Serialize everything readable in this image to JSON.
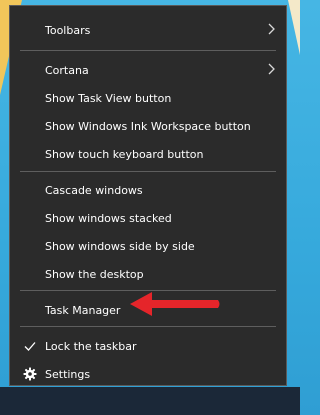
{
  "menu": {
    "items": [
      {
        "label": "Toolbars",
        "submenu": true
      },
      {
        "label": "Cortana",
        "submenu": true
      },
      {
        "label": "Show Task View button"
      },
      {
        "label": "Show Windows Ink Workspace button"
      },
      {
        "label": "Show touch keyboard button"
      },
      {
        "label": "Cascade windows"
      },
      {
        "label": "Show windows stacked"
      },
      {
        "label": "Show windows side by side"
      },
      {
        "label": "Show the desktop"
      },
      {
        "label": "Task Manager",
        "highlighted_by": "red arrow"
      },
      {
        "label": "Lock the taskbar",
        "checked": true
      },
      {
        "label": "Settings",
        "icon": "gear-icon"
      }
    ]
  },
  "colors": {
    "menu_background": "#2b2b2b",
    "menu_text": "#ffffff",
    "separator": "#5e5e5e",
    "annotation_arrow": "#e5252a",
    "taskbar": "#1b2838"
  }
}
